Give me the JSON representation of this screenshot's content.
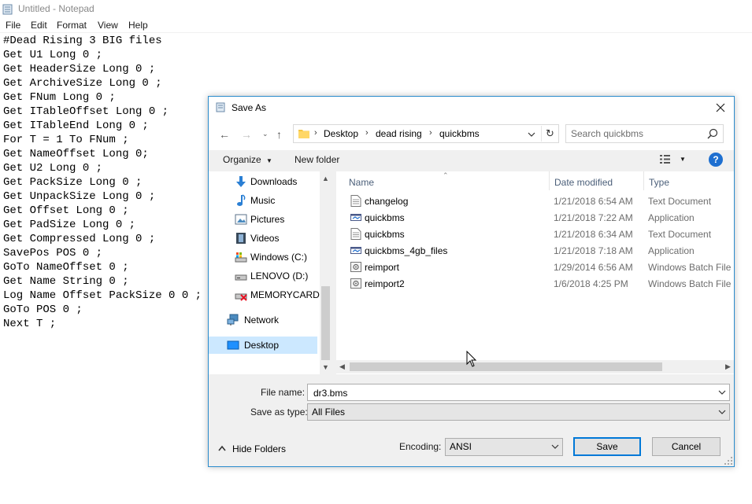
{
  "notepad": {
    "title": "Untitled - Notepad",
    "menu": [
      "File",
      "Edit",
      "Format",
      "View",
      "Help"
    ],
    "content": "#Dead Rising 3 BIG files\nGet U1 Long 0 ;\nGet HeaderSize Long 0 ;\nGet ArchiveSize Long 0 ;\nGet FNum Long 0 ;\nGet ITableOffset Long 0 ;\nGet ITableEnd Long 0 ;\nFor T = 1 To FNum ;\nGet NameOffset Long 0;\nGet U2 Long 0 ;\nGet PackSize Long 0 ;\nGet UnpackSize Long 0 ;\nGet Offset Long 0 ;\nGet PadSize Long 0 ;\nGet Compressed Long 0 ;\nSavePos POS 0 ;\nGoTo NameOffset 0 ;\nGet Name String 0 ;\nLog Name Offset PackSize 0 0 ;\nGoTo POS 0 ;\nNext T ;"
  },
  "dialog": {
    "title": "Save As",
    "breadcrumb": [
      "Desktop",
      "dead rising",
      "quickbms"
    ],
    "search_placeholder": "Search quickbms",
    "toolbar": {
      "organize": "Organize",
      "new_folder": "New folder",
      "help": "?"
    },
    "nav_items": [
      {
        "label": "Downloads",
        "icon": "downloads-icon"
      },
      {
        "label": "Music",
        "icon": "music-icon"
      },
      {
        "label": "Pictures",
        "icon": "pictures-icon"
      },
      {
        "label": "Videos",
        "icon": "videos-icon"
      },
      {
        "label": "Windows (C:)",
        "icon": "drive-c-icon"
      },
      {
        "label": "LENOVO (D:)",
        "icon": "drive-d-icon"
      },
      {
        "label": "MEMORYCARD",
        "icon": "memorycard-icon"
      },
      {
        "label": "Network",
        "icon": "network-icon"
      },
      {
        "label": "Desktop",
        "icon": "desktop-icon",
        "selected": true
      }
    ],
    "columns": {
      "name": "Name",
      "date": "Date modified",
      "type": "Type"
    },
    "files": [
      {
        "name": "changelog",
        "date": "1/21/2018 6:54 AM",
        "type": "Text Document",
        "icon": "text-file-icon"
      },
      {
        "name": "quickbms",
        "date": "1/21/2018 7:22 AM",
        "type": "Application",
        "icon": "application-icon"
      },
      {
        "name": "quickbms",
        "date": "1/21/2018 6:34 AM",
        "type": "Text Document",
        "icon": "text-file-icon"
      },
      {
        "name": "quickbms_4gb_files",
        "date": "1/21/2018 7:18 AM",
        "type": "Application",
        "icon": "application-icon"
      },
      {
        "name": "reimport",
        "date": "1/29/2014 6:56 AM",
        "type": "Windows Batch File",
        "icon": "batch-file-icon"
      },
      {
        "name": "reimport2",
        "date": "1/6/2018 4:25 PM",
        "type": "Windows Batch File",
        "icon": "batch-file-icon"
      }
    ],
    "file_name_label": "File name:",
    "file_name_value": "dr3.bms",
    "save_type_label": "Save as type:",
    "save_type_value": "All Files",
    "hide_folders": "Hide Folders",
    "encoding_label": "Encoding:",
    "encoding_value": "ANSI",
    "save_button": "Save",
    "cancel_button": "Cancel"
  },
  "colors": {
    "accent": "#0078d7",
    "selection": "#cce8ff",
    "dialog_border": "#2b8ccd",
    "help_blue": "#1e6fd0"
  }
}
